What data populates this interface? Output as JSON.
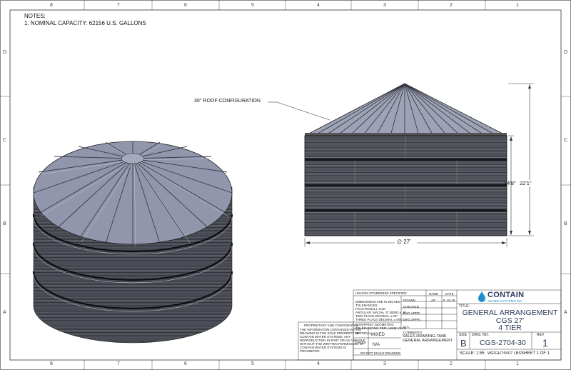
{
  "zones": {
    "columns": [
      "8",
      "7",
      "6",
      "5",
      "4",
      "3",
      "2",
      "1"
    ],
    "rows": [
      "D",
      "C",
      "B",
      "A"
    ]
  },
  "notes": {
    "header": "NOTES:",
    "items": [
      "1.    NOMINAL CAPACITY: 62156 U.S. GALLONS"
    ]
  },
  "callout": "30° ROOF CONFIGURATION",
  "dimensions": {
    "diameter": "∅ 27'",
    "wall_height": "14'8\"",
    "total_height": "22'1\""
  },
  "title_block": {
    "spec_lines": [
      "UNLESS OTHERWISE SPECIFIED:",
      "DIMENSIONS ARE IN INCHES",
      "TOLERANCES:",
      "FRACTIONAL± 1/16\"",
      "ANGULAR: MACH± .5° BEND ± .5°",
      "TWO PLACE DECIMAL  ±.02\"",
      "THREE PLACE DECIMAL  ±.005\""
    ],
    "interpret": [
      "INTERPRET GEOMETRIC",
      "TOLERANCING PER: ASME Y14.5"
    ],
    "material_label": "MATERIAL",
    "material_value": "MIXED",
    "finish_label": "FINISH",
    "finish_value": "N/A",
    "do_not_scale": "DO NOT SCALE DRAWING",
    "proprietary": [
      "PROPRIETARY AND CONFIDENTIAL",
      "THE INFORMATION CONTAINED IN THIS",
      "DRAWING IS THE SOLE PROPERTY OF",
      "CONTAIN WATER SYSTEMS. ANY",
      "REPRODUCTION IN PART OR AS A WHOLE",
      "WITHOUT THE WRITTEN PERMISSION OF",
      "CONTAIN WATER SYSTEMS IS",
      "PROHIBITED."
    ],
    "approvals": [
      {
        "label": "DRAWN",
        "name": "AP",
        "date": "9. 26.18"
      },
      {
        "label": "CHECKED",
        "name": "",
        "date": ""
      },
      {
        "label": "ENG APPR.",
        "name": "",
        "date": ""
      },
      {
        "label": "MFG APPR.",
        "name": "",
        "date": ""
      },
      {
        "label": "Q.A.",
        "name": "",
        "date": ""
      }
    ],
    "name_header": "NAME",
    "date_header": "DATE",
    "comments_label": "COMMENTS:",
    "comments": [
      "SALES DRAWING-TANK",
      "GENERAL ARRANGEMENT"
    ],
    "logo_name": "CONTAIN",
    "logo_sub": "WATER SYSTEMS INC.",
    "title_label": "TITLE:",
    "title_lines": [
      "GENERAL ARRANGEMENT",
      "CGS 27'",
      "4 TIER"
    ],
    "size_label": "SIZE",
    "size_value": "B",
    "dwg_label": "DWG.  NO.",
    "dwg_value": "CGS-2704-30",
    "rev_label": "REV",
    "rev_value": "1",
    "scale": "SCALE: 1:55",
    "weight": "WEIGHT:5007 LBS",
    "sheet": "SHEET 1 OF 1"
  },
  "colors": {
    "roof": "#8f93aa",
    "roof_light": "#b3b6c8",
    "wall": "#2a2c33",
    "accent": "#2d3a5a",
    "logo_blue": "#1f8fd0"
  }
}
